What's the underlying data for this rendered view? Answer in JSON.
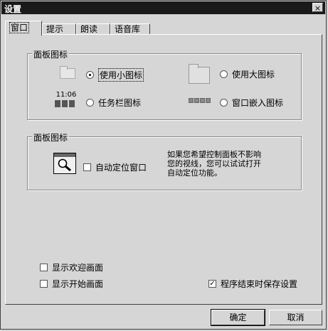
{
  "window": {
    "title": "设置",
    "close_glyph": "×"
  },
  "tabs": [
    {
      "label": "窗口",
      "active": true
    },
    {
      "label": "提示",
      "active": false
    },
    {
      "label": "朗读",
      "active": false
    },
    {
      "label": "语音库",
      "active": false
    }
  ],
  "group1": {
    "label": "面板图标",
    "options": [
      {
        "label": "使用小图标",
        "selected": true,
        "icon": "small-folder-icon"
      },
      {
        "label": "使用大图标",
        "selected": false,
        "icon": "large-folder-icon"
      },
      {
        "label": "任务栏图标",
        "selected": false,
        "icon": "taskbar-tray-icon",
        "tray_time": "11:06"
      },
      {
        "label": "窗口嵌入图标",
        "selected": false,
        "icon": "window-embed-icon"
      }
    ]
  },
  "group2": {
    "label": "面板图标",
    "auto_position": {
      "label": "自动定位窗口",
      "checked": false
    },
    "description": [
      "如果您希望控制面板不影响",
      "您的视线，您可以试试打开",
      "自动定位功能。"
    ]
  },
  "options": {
    "show_welcome": {
      "label": "显示欢迎画面",
      "checked": false
    },
    "show_start": {
      "label": "显示开始画面",
      "checked": false
    },
    "save_on_exit": {
      "label": "程序结束时保存设置",
      "checked": true
    }
  },
  "buttons": {
    "ok": "确定",
    "cancel": "取消"
  }
}
